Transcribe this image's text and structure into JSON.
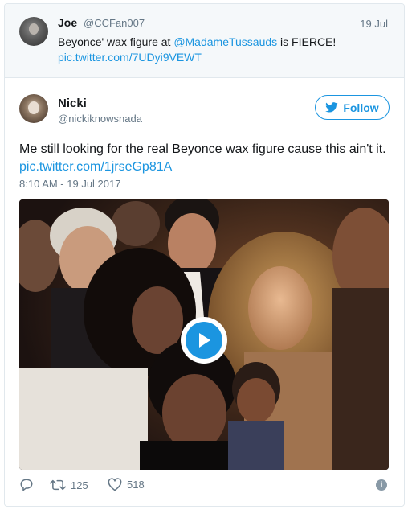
{
  "quoted_tweet": {
    "name": "Joe",
    "handle": "@CCFan007",
    "date": "19 Jul",
    "text_prefix": "Beyonce' wax figure at ",
    "mention": "@MadameTussauds",
    "text_suffix": " is FIERCE!",
    "link": "pic.twitter.com/7UDyi9VEWT"
  },
  "tweet": {
    "name": "Nicki",
    "handle": "@nickiknowsnada",
    "follow_label": "Follow",
    "text": "Me still looking for the real Beyonce wax figure cause this ain't it.",
    "link": "pic.twitter.com/1jrseGp81A",
    "timestamp": "8:10 AM - 19 Jul 2017"
  },
  "actions": {
    "retweet_count": "125",
    "like_count": "518"
  },
  "icons": {
    "reply": "reply-icon",
    "retweet": "retweet-icon",
    "like": "heart-icon",
    "info": "info-icon",
    "play": "play-icon",
    "follow": "twitter-bird-icon"
  },
  "colors": {
    "accent": "#1b95e0",
    "secondary_text": "#657786",
    "primary_text": "#14171a",
    "quoted_bg": "#f5f8fa"
  }
}
